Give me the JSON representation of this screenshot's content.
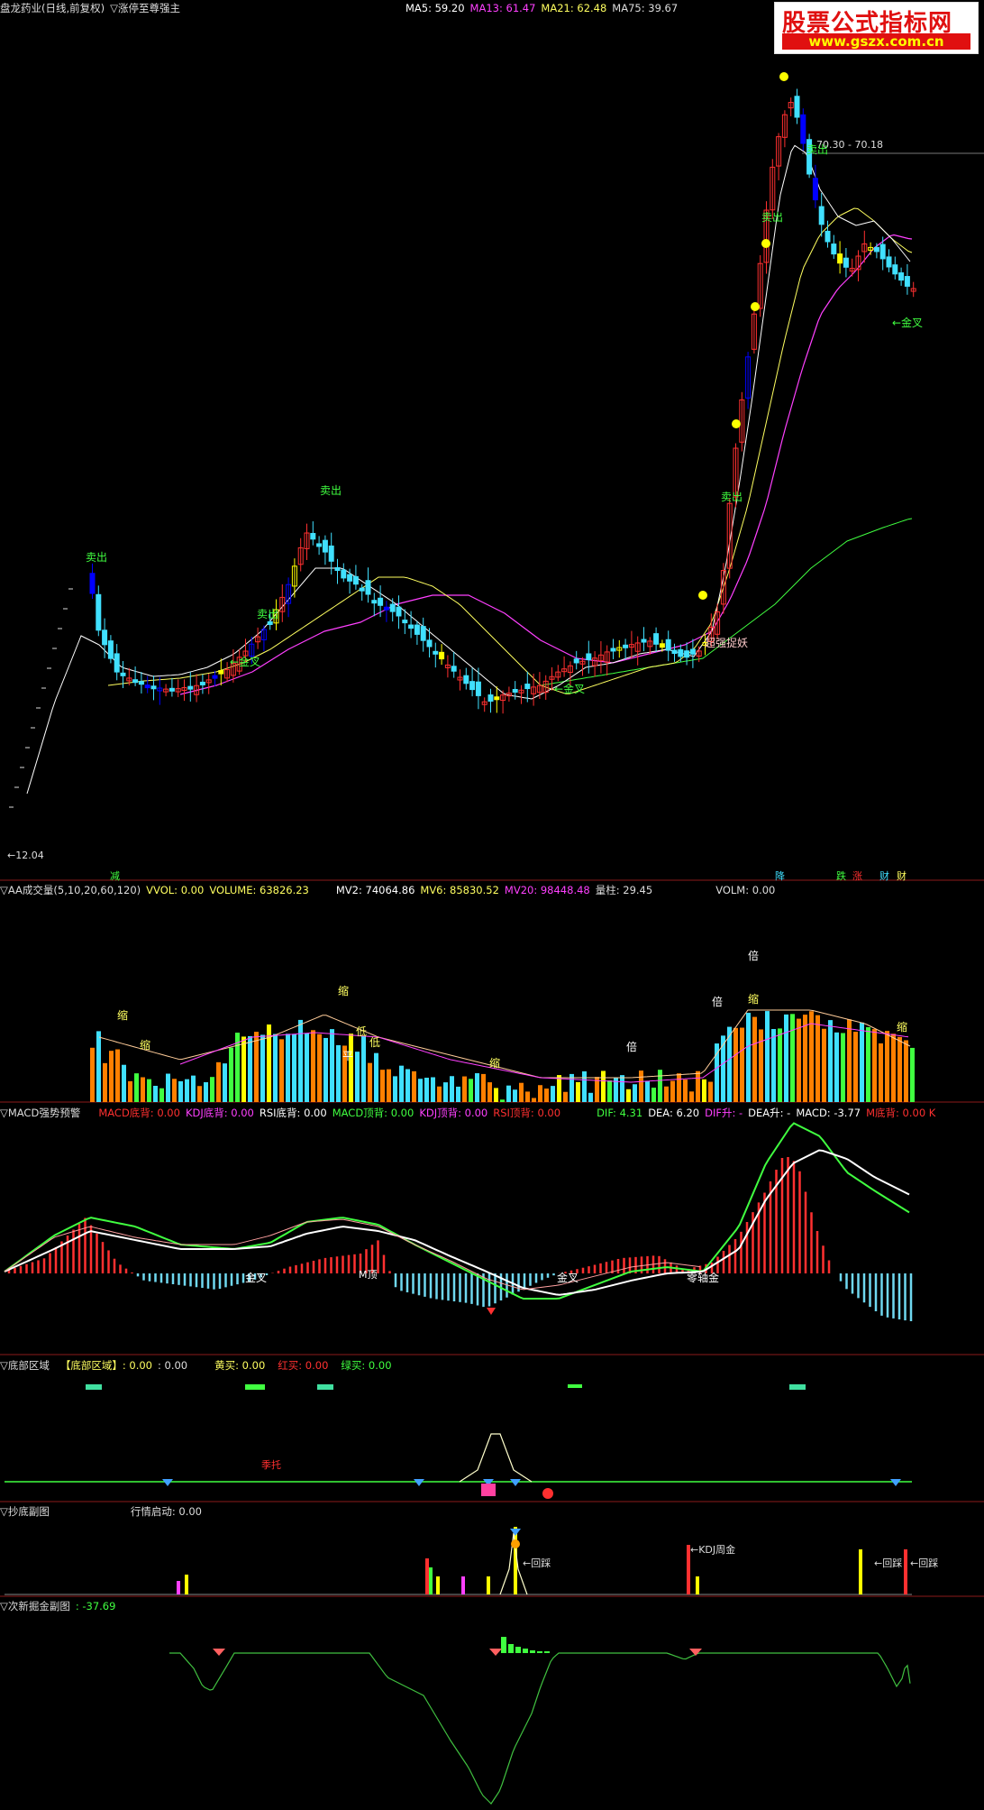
{
  "window": {
    "title": "盘龙药业(日线,前复权)",
    "indicator": "▽涨停至尊强主"
  },
  "main_legend": {
    "ma5": "MA5: 59.20",
    "ma13": "MA13: 61.47",
    "ma21": "MA21: 62.48",
    "ma75": "MA75: 39.67"
  },
  "watermark": {
    "line1": "股票公式指标网",
    "line2": "www.gszx.com.cn"
  },
  "colors": {
    "bg": "#000000",
    "up": "#ff3030",
    "down": "#40e0ff",
    "yellow": "#ffff00",
    "magenta": "#ff40ff",
    "green": "#40ff40",
    "white": "#ffffff",
    "blue": "#0000ff"
  },
  "main_labels": {
    "price_high": "70.30 - 70.18",
    "price_low": "12.04",
    "sell": "卖出",
    "gold_cross": "金叉",
    "breakout": "超强捉妖",
    "bottom_tags": [
      "减",
      "降",
      "跌",
      "涨",
      "财",
      "财"
    ]
  },
  "volume_legend": {
    "name": "▽AA成交量(5,10,20,60,120)",
    "vvol": "VVOL: 0.00",
    "volume": "VOLUME: 63826.23",
    "mv2": "MV2: 74064.86",
    "mv6": "MV6: 85830.52",
    "mv20": "MV20: 98448.48",
    "liangzhu": "量柱: 29.45",
    "volm": "VOLM: 0.00"
  },
  "volume_labels": {
    "shrink": "缩",
    "double": "倍",
    "flat": "平",
    "low": "低"
  },
  "macd_legend": {
    "name": "▽MACD强势预警",
    "macd_bottom": "MACD底背: 0.00",
    "kdj_bottom": "KDJ底背: 0.00",
    "rsi_bottom": "RSI底背: 0.00",
    "macd_top": "MACD顶背: 0.00",
    "kdj_top": "KDJ顶背: 0.00",
    "rsi_top": "RSI顶背: 0.00",
    "dif": "DIF: 4.31",
    "dea": "DEA: 6.20",
    "dif_up": "DIF升: -",
    "dea_up": "DEA升: -",
    "macd": "MACD: -3.77",
    "m_bottom": "M底背: 0.00 K"
  },
  "macd_labels": {
    "gold_cross": "金叉",
    "m_top": "M顶",
    "zero_gold": "零轴金"
  },
  "bottom_legend": {
    "name": "▽底部区域",
    "zone": "【底部区域】: 0.00",
    "zone2": ": 0.00",
    "yellow_buy": "黄买: 0.00",
    "red_buy": "红买: 0.00",
    "green_buy": "绿买: 0.00"
  },
  "bottom_labels": {
    "jituo": "季托"
  },
  "chaodi_legend": {
    "name": "▽抄底副图",
    "start": "行情启动: 0.00"
  },
  "chaodi_labels": {
    "huicai": "回踩",
    "kdj_week": "KDJ周金"
  },
  "cixin_legend": {
    "name": "▽次新掘金副图",
    "value": ": -37.69"
  },
  "chart_data": {
    "type": "candlestick",
    "title": "盘龙药业(日线,前复权)",
    "price_range": [
      12.04,
      70.3
    ],
    "series": [
      {
        "name": "MA5",
        "last": 59.2
      },
      {
        "name": "MA13",
        "last": 61.47
      },
      {
        "name": "MA21",
        "last": 62.48
      },
      {
        "name": "MA75",
        "last": 39.67
      }
    ],
    "volume": {
      "volume": 63826.23,
      "mv2": 74064.86,
      "mv6": 85830.52,
      "mv20": 98448.48
    },
    "macd": {
      "dif": 4.31,
      "dea": 6.2,
      "macd": -3.77
    },
    "cixin": -37.69
  }
}
